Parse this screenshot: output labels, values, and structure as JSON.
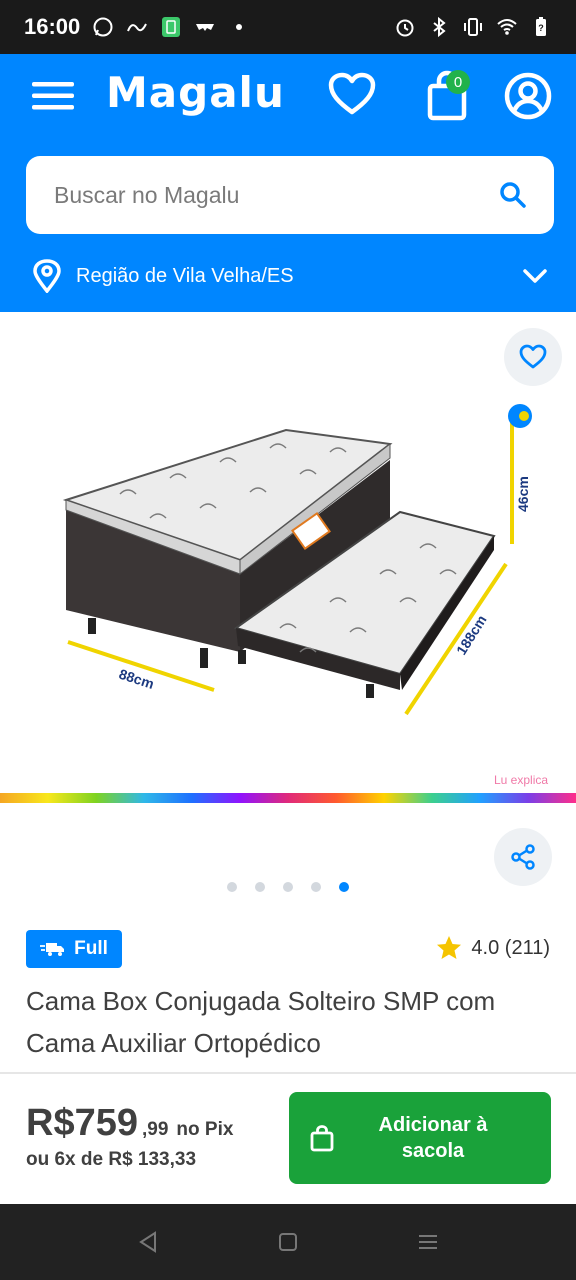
{
  "status_bar": {
    "time": "16:00",
    "icons_left": [
      "whatsapp-icon",
      "link-icon",
      "green-app-icon",
      "glasses-icon",
      "dot-icon"
    ],
    "icons_right": [
      "alarm-icon",
      "bluetooth-icon",
      "vibrate-icon",
      "wifi-icon",
      "battery-icon"
    ]
  },
  "header": {
    "logo": "Magalu",
    "cart_count": "0",
    "colors": {
      "brand_blue": "#0086ff",
      "badge_green": "#21b24b"
    }
  },
  "search": {
    "placeholder": "Buscar no Magalu"
  },
  "region": {
    "label": "Região de Vila Velha/ES"
  },
  "gallery": {
    "dimensions": {
      "width": "88cm",
      "length": "188cm",
      "height": "46cm"
    },
    "watermark": "Lu explica",
    "dots_total": 5,
    "active_dot": 5
  },
  "product": {
    "badge": "Full",
    "rating": "4.0 (211)",
    "title": "Cama Box Conjugada Solteiro SMP com Cama Auxiliar Ortopédico"
  },
  "price": {
    "main": "R$759",
    "cents": ",99",
    "pix_label": "no Pix",
    "installments": "ou 6x de R$ 133,33"
  },
  "cta": {
    "label_line1": "Adicionar à",
    "label_line2": "sacola",
    "color": "#1aa23a"
  },
  "nav_bar": {
    "buttons": [
      "back-icon",
      "home-icon",
      "recents-icon"
    ]
  }
}
